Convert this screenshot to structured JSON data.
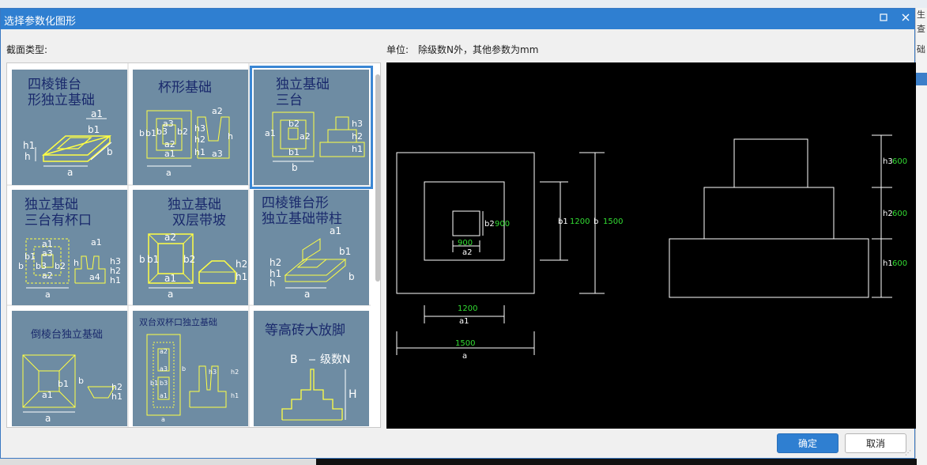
{
  "dialog": {
    "title": "选择参数化图形",
    "maximize_icon": "maximize-icon",
    "close_icon": "close-icon",
    "section_label": "截面类型:",
    "unit_label": "单位:",
    "unit_desc": "除级数N外，其他参数为mm",
    "ok_label": "确定",
    "cancel_label": "取消"
  },
  "thumbnails": [
    {
      "title1": "四棱锥台",
      "title2": "形独立基础",
      "labels": [
        "a1",
        "b1",
        "h1",
        "h",
        "a",
        "b"
      ]
    },
    {
      "title1": "杯形基础",
      "title2": "",
      "labels": [
        "a2",
        "a3",
        "b",
        "b1",
        "b3",
        "b2",
        "a2",
        "a1",
        "h3",
        "h2",
        "h1",
        "h",
        "a3",
        "a"
      ]
    },
    {
      "title1": "独立基础",
      "title2": "三台",
      "labels": [
        "a1",
        "b2",
        "a2",
        "b1",
        "b",
        "h3",
        "h2",
        "h1"
      ]
    },
    {
      "title1": "独立基础",
      "title2": "三台有杯口",
      "labels": [
        "a1",
        "a3",
        "b1",
        "b3",
        "b2",
        "a2",
        "b",
        "a",
        "h",
        "a4",
        "h3",
        "h2",
        "h1"
      ]
    },
    {
      "title1": "独立基础",
      "title2": "双层带坡",
      "labels": [
        "a2",
        "b",
        "b1",
        "b2",
        "a1",
        "a",
        "h2",
        "h1"
      ]
    },
    {
      "title1": "四棱锥台形",
      "title2": "独立基础带柱",
      "labels": [
        "a1",
        "b1",
        "h2",
        "h1",
        "h",
        "b",
        "a"
      ]
    },
    {
      "title1": "倒棱台独立基础",
      "title2": "",
      "labels": [
        "b1",
        "a1",
        "b",
        "h2",
        "h1",
        "a"
      ]
    },
    {
      "title1": "双台双杯口独立基础",
      "title2": "",
      "labels": [
        "a2",
        "a3",
        "b1",
        "b3",
        "a1",
        "b",
        "h3",
        "h2",
        "h1",
        "a"
      ]
    },
    {
      "title1": "等高砖大放脚",
      "title2": "",
      "labels": [
        "B",
        "级数N",
        "H"
      ]
    }
  ],
  "preview": {
    "plan_dims": {
      "a": "1500",
      "a1": "1200",
      "a2": "900",
      "b2": "900",
      "b1": "1200",
      "b": "1500"
    },
    "plan_labels": {
      "a": "a",
      "a1": "a1",
      "a2": "a2",
      "b2": "b2",
      "b1": "b1",
      "b": "b"
    },
    "elev_labels": [
      {
        "name": "h3",
        "value": "600"
      },
      {
        "name": "h2",
        "value": "600"
      },
      {
        "name": "h1",
        "value": "600"
      }
    ]
  },
  "background": {
    "right_texts": [
      "生",
      "查",
      "础"
    ]
  }
}
